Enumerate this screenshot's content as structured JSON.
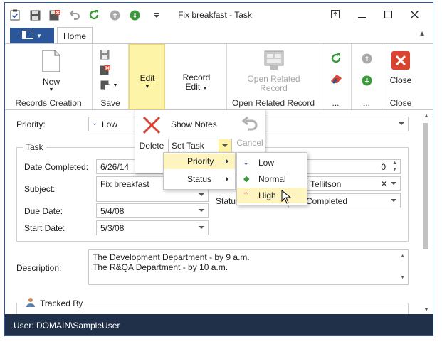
{
  "window": {
    "title": "Fix breakfast - Task"
  },
  "qat": {
    "icons": [
      "task-icon",
      "save-icon",
      "save-close-icon",
      "undo-icon",
      "refresh-icon",
      "prev-record-icon",
      "next-record-icon",
      "customize-qat-icon"
    ]
  },
  "ribbon": {
    "tabs": {
      "home": "Home"
    },
    "groups": {
      "records_creation": {
        "label": "Records Creation",
        "new_label": "New"
      },
      "save": {
        "label": "Save"
      },
      "edit": {
        "label": "Edit"
      },
      "record_edit": {
        "label_line1": "Record",
        "label_line2": "Edit"
      },
      "open_related": {
        "label": "Open Related Record",
        "button_line1": "Open Related",
        "button_line2": "Record"
      },
      "refresh": {
        "label": "..."
      },
      "navigation": {
        "label": "..."
      },
      "close": {
        "label": "Close",
        "button": "Close"
      }
    }
  },
  "form": {
    "priority": {
      "label": "Priority:",
      "value": "Low"
    },
    "task_group": {
      "title": "Task"
    },
    "date_completed": {
      "label": "Date Completed:",
      "value": "6/26/14"
    },
    "subject": {
      "label": "Subject:",
      "value": "Fix breakfast"
    },
    "due_date": {
      "label": "Due Date:",
      "value": "5/4/08"
    },
    "start_date": {
      "label": "Start Date:",
      "value": "5/3/08"
    },
    "percent_complete": {
      "value": "0"
    },
    "assigned_to": {
      "value": "Tellitson"
    },
    "status": {
      "label": "Status",
      "value": "Completed"
    },
    "description": {
      "label": "Description:",
      "line1": "The Development Department - by 9 a.m.",
      "line2": "The R&QA Department - by 10 a.m."
    },
    "tracked_by": {
      "title": "Tracked By"
    }
  },
  "popup": {
    "delete": "Delete",
    "show_notes": "Show Notes",
    "cancel": "Cancel",
    "set_task": "Set Task",
    "submenu": {
      "priority": "Priority",
      "status": "Status"
    },
    "priority_options": {
      "low": "Low",
      "normal": "Normal",
      "high": "High"
    }
  },
  "status_bar": {
    "user": "User: DOMAIN\\SampleUser"
  },
  "colors": {
    "accent": "#2b579a",
    "status_bar": "#1f3048",
    "edit_highlight": "#fdf4a7",
    "menu_hover": "#fdf4bf",
    "close_red": "#d9432f",
    "refresh_green": "#3a9a3a"
  }
}
